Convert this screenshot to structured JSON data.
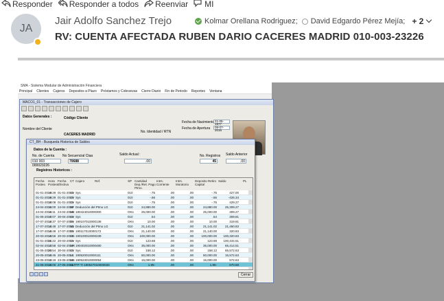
{
  "toolbar": {
    "reply": "Responder",
    "reply_all": "Responder a todos",
    "forward": "Reenviar",
    "im": "MI"
  },
  "message": {
    "avatar_initials": "JA",
    "sender": "Jair Adolfo Sanchez Trejo",
    "recipient_1": "Kolmar Orellana Rodriguez;",
    "recipient_2": "David Edgardo Pérez Mejía;",
    "more_recipients": "+ 2",
    "subject": "RV: CUENTA AFECTADA RUBEN DARIO CACERES MADRID 010-003-23226"
  },
  "embedded": {
    "app_title": "SMA - Sistema Modular de Administración Financiera",
    "menu": [
      "Principal",
      "Clientes",
      "Cajeros",
      "Depositos a Plazo",
      "Préstamos y Cobranzas",
      "Cierre Diario",
      "Fin de Periodo",
      "Reportes",
      "Ventana"
    ],
    "win1_title": "MACO1_01 - Transacciones de Cajero",
    "datos_generales": "Datos Generales :",
    "codigo_cliente": "Código Cliente",
    "nombre_cliente": "Nombre del Cliente",
    "nombre_cliente_value": "CACERES MADRID",
    "fecha_nacimiento_lbl": "Fecha de Nacimiento",
    "fecha_nacimiento": "21-05-1977",
    "fecha_apertura_lbl": "Fecha de Apertura",
    "fecha_apertura": "08-07-2016",
    "identidad_lbl": "No. Identidad / RTN",
    "win2_title": "CT_BH - Busqueda Historica de Saldos",
    "datos_cuenta": "Datos de la Cuenta :",
    "no_cuenta_lbl": "No. de Cuenta",
    "no_cuenta": "010 003 000023226",
    "no_secuencial_lbl": "No Secuencial Ctaa",
    "no_secuencial": "70688",
    "saldo_actual_lbl": "Saldo Actual :",
    "saldo_actual": ".00",
    "no_registros_lbl": "No. Registros",
    "no_registros": "45",
    "saldo_anterior_lbl": "Saldo Anterior",
    "saldo_anterior": ".00",
    "registros_historicos": "Registros Historicos :",
    "columns": [
      "Fecha Posteo",
      "Hora Posteo",
      "Fecha Efectiva",
      "CT",
      "Cajero",
      "Ref.",
      "SP",
      "Cantidad Dep./Ret. Pago Ptmo.",
      "Intrs. Corriente",
      "Intrs. Moratorio",
      "Deposito Retiro Capital",
      "Saldo",
      "PL"
    ],
    "rows": [
      [
        "01-01-2016",
        "19:29",
        "01-01-2016",
        "CV",
        "Sys",
        "",
        "010",
        "-.75",
        ".00",
        ".00",
        "-.75",
        "427.00"
      ],
      [
        "01-01-2016",
        "19:29",
        "01-01-2016",
        "CV",
        "Sys",
        "",
        "010",
        "-.66",
        ".00",
        ".00",
        "-.66",
        "-426.34"
      ],
      [
        "01-01-2016",
        "18:08",
        "01-01-2016",
        "CV",
        "Sys",
        "",
        "010",
        "-.75",
        ".00",
        ".00",
        "-.75",
        "429.27"
      ],
      [
        "24-04-2016",
        "15:00",
        "24-04-2016",
        "BP",
        "Deducción del Ptmo LG",
        "",
        "010",
        "24,880.00",
        ".00",
        ".00",
        "24,880.00",
        "25,309.27"
      ],
      [
        "24-04-2016",
        "15:11",
        "24-04-2016",
        "ME",
        "180424010000300",
        "",
        "OKs",
        "25,000.00",
        ".00",
        ".00",
        "25,000.00",
        "309.27"
      ],
      [
        "01-06-2016",
        "17:07",
        "30-04-2016",
        "CV",
        "Sys",
        "",
        "010",
        ".54",
        ".00",
        ".00",
        ".54",
        "309.81"
      ],
      [
        "07-07-2016",
        "12:37",
        "07-07-2016",
        "DV",
        "190107010000138",
        "",
        "OKs",
        "10.00",
        ".00",
        ".00",
        "10.00",
        "319.81"
      ],
      [
        "17-07-2016",
        "14:48",
        "17-07-2016",
        "NS",
        "Deducción del Ptmo LG",
        "",
        "010",
        "21,141.02",
        ".00",
        ".00",
        "21,141.02",
        "21,460.83"
      ],
      [
        "17-07-2016",
        "14:48",
        "17-07-2016",
        "DV",
        "190117010000172",
        "",
        "OKs",
        "21,140.00",
        ".00",
        ".00",
        "21,140.00",
        "320.83"
      ],
      [
        "20-03-2016",
        "14:56",
        "20-03-2016",
        "CG",
        "190100010000239",
        "",
        "OKs",
        "100,000.00",
        ".00",
        ".00",
        "100,000.00",
        "100,320.83"
      ],
      [
        "01-01-2016",
        "21:22",
        "20-03-2016",
        "CV",
        "Sys",
        "",
        "010",
        "123.68",
        ".00",
        ".00",
        "123.68",
        "100,444.51"
      ],
      [
        "02-04-2016",
        "13:58",
        "02-04-2016",
        "MR",
        "190402010000480",
        "",
        "OKs",
        "35,000.00",
        ".00",
        ".00",
        "35,000.00",
        "65,414.51"
      ],
      [
        "01-05-2016",
        "20:54",
        "30-04-2016",
        "CV",
        "Sys",
        "",
        "010",
        "158.12",
        ".00",
        ".00",
        "158.12",
        "65,572.63"
      ],
      [
        "20-05-2016",
        "10:45",
        "20-05-2016",
        "LC",
        "190520010000111",
        "",
        "OKs",
        "50,000.00",
        ".00",
        ".00",
        "50,000.00",
        "15,572.63"
      ],
      [
        "23-05-2016",
        "13:19",
        "23-05-2016",
        "MS",
        "190523010000094",
        "",
        "OKs",
        "15,000.00",
        ".00",
        ".00",
        "15,000.00",
        "572.63"
      ],
      [
        "21-06-2016",
        "16:00",
        "27-05-2016",
        "CLT",
        "FP TI 190527010000020",
        "",
        "OKs",
        "1.95-",
        ".00",
        ".00",
        "1.95-",
        "570.68"
      ]
    ],
    "cerrar": "Cerrar"
  }
}
